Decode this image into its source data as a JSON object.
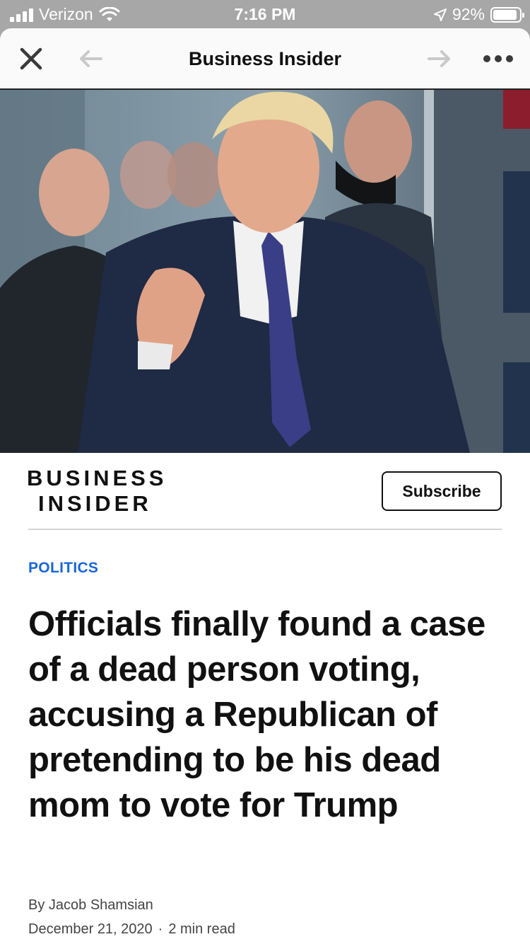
{
  "status_bar": {
    "carrier": "Verizon",
    "time": "7:16 PM",
    "battery": "92%",
    "battery_level": 0.92
  },
  "nav": {
    "title": "Business Insider",
    "close_icon": "close-icon",
    "back_icon": "arrow-left-icon",
    "forward_icon": "arrow-right-icon",
    "more_icon": "more-horizontal-icon"
  },
  "hero": {
    "icon": "photo"
  },
  "brand": {
    "line1": "BUSINESS",
    "line2": "INSIDER",
    "subscribe_label": "Subscribe"
  },
  "article": {
    "category": "POLITICS",
    "headline": "Officials finally found a case of a dead person voting, accusing a Republican of pretending to be his dead mom to vote for Trump",
    "byline": "By Jacob Shamsian",
    "date": "December 21, 2020",
    "read_time": "2 min read"
  },
  "colors": {
    "accent": "#1a66d6",
    "status_bar_bg": "#a7a7a7"
  }
}
